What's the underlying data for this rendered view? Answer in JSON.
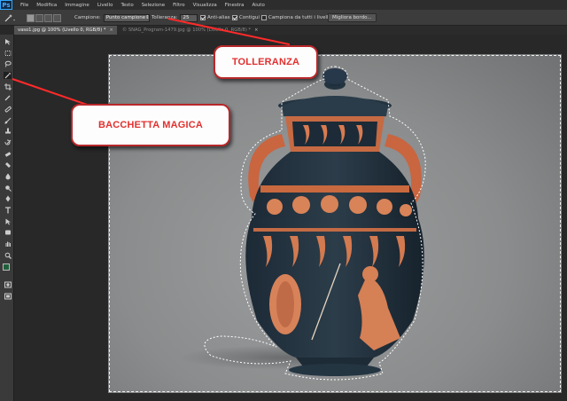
{
  "app": {
    "logo": "Ps"
  },
  "menu": [
    "File",
    "Modifica",
    "Immagine",
    "Livello",
    "Testo",
    "Selezione",
    "Filtro",
    "Visualizza",
    "Finestra",
    "Aiuto"
  ],
  "options": {
    "campione_label": "Campione:",
    "campione_value": "Punto campione",
    "tolleranza_label": "Tolleranza:",
    "tolleranza_value": "25",
    "antialias_label": "Anti-alias",
    "contigui_label": "Contigui",
    "tutti_livelli_label": "Campiona da tutti i livelli",
    "migliora_bordo": "Migliora bordo..."
  },
  "tabs": [
    {
      "label": "vaso1.jpg @ 100% (Livello 0, RGB/8) *",
      "close": "×"
    },
    {
      "label": "© SNAG_Program-1479.jpg @ 100% (Livello 0, RGB/8) *",
      "close": "×"
    }
  ],
  "callouts": {
    "tolleranza": "TOLLERANZA",
    "bacchetta": "BACCHETTA MAGICA"
  },
  "colors": {
    "callout_border": "#b8282b",
    "callout_text": "#e0312f",
    "foreground_swatch": "#1f5f3a",
    "background_swatch": "#f2f2f2"
  },
  "tools": [
    "move-icon",
    "marquee-icon",
    "lasso-icon",
    "magic-wand-icon",
    "crop-icon",
    "eyedropper-icon",
    "healing-icon",
    "brush-icon",
    "stamp-icon",
    "history-brush-icon",
    "eraser-icon",
    "gradient-icon",
    "blur-icon",
    "dodge-icon",
    "pen-icon",
    "type-icon",
    "path-select-icon",
    "shape-icon",
    "hand-icon",
    "zoom-icon"
  ]
}
